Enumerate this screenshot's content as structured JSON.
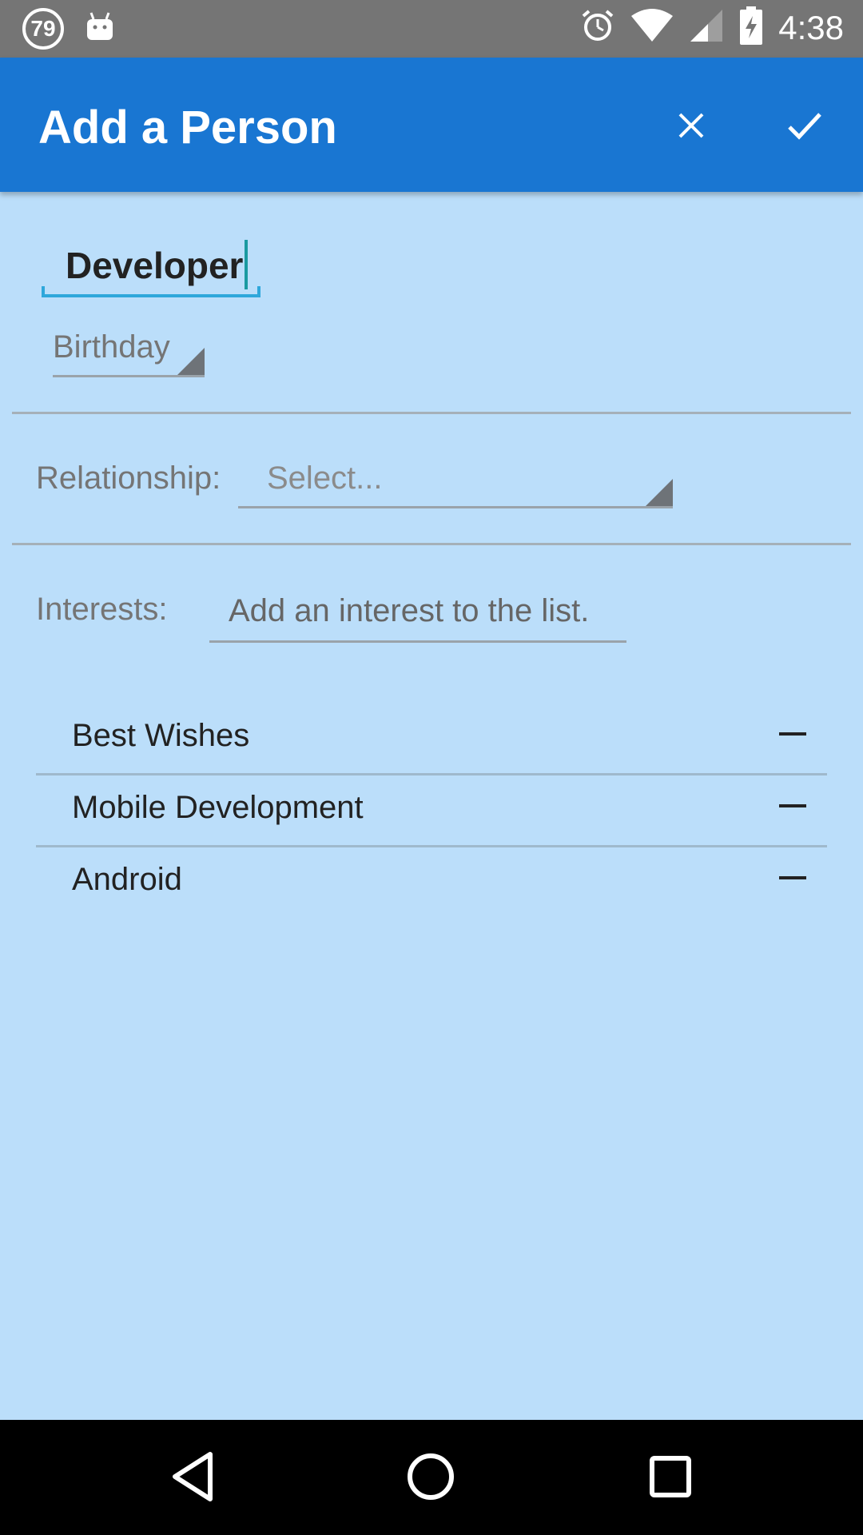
{
  "status_bar": {
    "notification_count": "79",
    "time": "4:38",
    "icons": [
      "notification-count-icon",
      "android-icon",
      "alarm-icon",
      "wifi-icon",
      "signal-icon",
      "battery-charging-icon"
    ]
  },
  "app_bar": {
    "title": "Add a Person",
    "close_icon": "close-icon",
    "confirm_icon": "check-icon",
    "background": "#1976D2"
  },
  "form": {
    "name_value": "Developer",
    "birthday_placeholder": "Birthday",
    "relationship_label": "Relationship:",
    "relationship_value": "Select...",
    "interests_label": "Interests:",
    "interest_placeholder": "Add an interest to the list."
  },
  "interests": [
    {
      "label": "Best Wishes"
    },
    {
      "label": "Mobile Development"
    },
    {
      "label": "Android"
    }
  ],
  "nav_bar": {
    "icons": [
      "back-icon",
      "home-icon",
      "recents-icon"
    ]
  },
  "colors": {
    "background": "#BBDEFA",
    "accent": "#2EA7DB"
  }
}
